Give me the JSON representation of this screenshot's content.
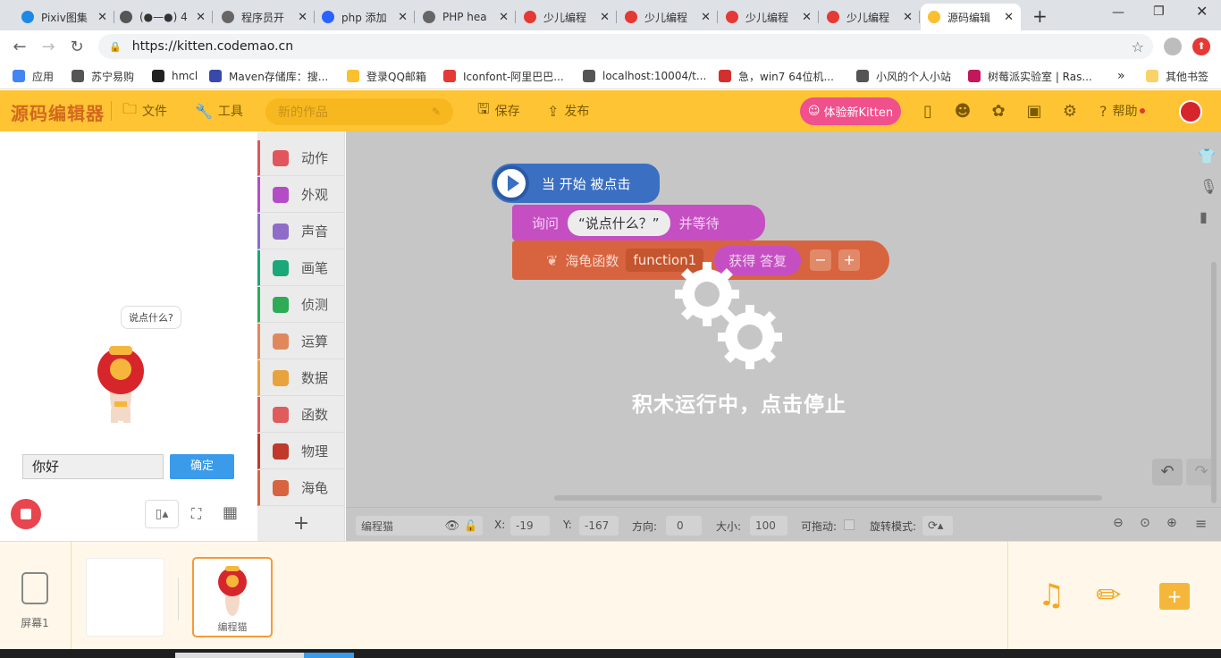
{
  "browser": {
    "tabs": [
      {
        "label": "Pixiv图集",
        "color": "#1e88e5"
      },
      {
        "label": "(●—●) 4",
        "color": "#555555"
      },
      {
        "label": "程序员开",
        "color": "#666666"
      },
      {
        "label": "php 添加",
        "color": "#2962ff"
      },
      {
        "label": "PHP hea",
        "color": "#666666"
      },
      {
        "label": "少儿编程",
        "color": "#e53935"
      },
      {
        "label": "少儿编程",
        "color": "#e53935"
      },
      {
        "label": "少儿编程",
        "color": "#e53935"
      },
      {
        "label": "少儿编程",
        "color": "#e53935"
      },
      {
        "label": "源码编辑",
        "color": "#fbc02d"
      }
    ],
    "new_tab": "+",
    "url": "https://kitten.codemao.cn",
    "bookmarks": [
      {
        "label": "应用",
        "color": "#4285f4"
      },
      {
        "label": "苏宁易购",
        "color": "#555555"
      },
      {
        "label": "hmcl",
        "color": "#222222"
      },
      {
        "label": "Maven存储库：搜...",
        "color": "#3949ab"
      },
      {
        "label": "登录QQ邮箱",
        "color": "#fbc02d"
      },
      {
        "label": "Iconfont-阿里巴巴...",
        "color": "#e53935"
      },
      {
        "label": "localhost:10004/t...",
        "color": "#555555"
      },
      {
        "label": "急，win7 64位机...",
        "color": "#d32f2f"
      },
      {
        "label": "小风的个人小站",
        "color": "#555555"
      },
      {
        "label": "树莓派实验室 | Ras...",
        "color": "#c2185b"
      }
    ],
    "more": "»",
    "other_bookmarks": "其他书签"
  },
  "app": {
    "logo": "源码编辑器",
    "file": "文件",
    "tools": "工具",
    "project_name_placeholder": "新的作品",
    "save": "保存",
    "publish": "发布",
    "try_new": "体验新Kitten",
    "help": "帮助"
  },
  "stage": {
    "speech": "说点什么?",
    "answer_value": "你好",
    "confirm": "确定"
  },
  "categories": [
    {
      "label": "动作",
      "color": "#e0565c"
    },
    {
      "label": "外观",
      "color": "#b44cc8"
    },
    {
      "label": "声音",
      "color": "#8e6cc8"
    },
    {
      "label": "画笔",
      "color": "#1aa77a"
    },
    {
      "label": "侦测",
      "color": "#2eab55"
    },
    {
      "label": "运算",
      "color": "#e0885c"
    },
    {
      "label": "数据",
      "color": "#e8a33d"
    },
    {
      "label": "函数",
      "color": "#e05c5c"
    },
    {
      "label": "物理",
      "color": "#c0392b"
    },
    {
      "label": "海龟",
      "color": "#d8633f"
    }
  ],
  "add_category": "+",
  "blocks": {
    "when_start": "当 开始 被点击",
    "ask": "询问",
    "ask_text": "“说点什么？”",
    "and_wait": "并等待",
    "turtle_func": "海龟函数",
    "func_name": "function1",
    "get_answer": "获得 答复",
    "minus": "−",
    "plus": "+"
  },
  "running_text": "积木运行中，点击停止",
  "status": {
    "sprite_name": "编程猫",
    "x_label": "X:",
    "x_value": "-19",
    "y_label": "Y:",
    "y_value": "-167",
    "dir_label": "方向:",
    "dir_value": "0",
    "size_label": "大小:",
    "size_value": "100",
    "drag_label": "可拖动:",
    "rotate_label": "旋转模式:"
  },
  "tray": {
    "screen_label": "屏幕1",
    "sprite_label": "编程猫"
  }
}
